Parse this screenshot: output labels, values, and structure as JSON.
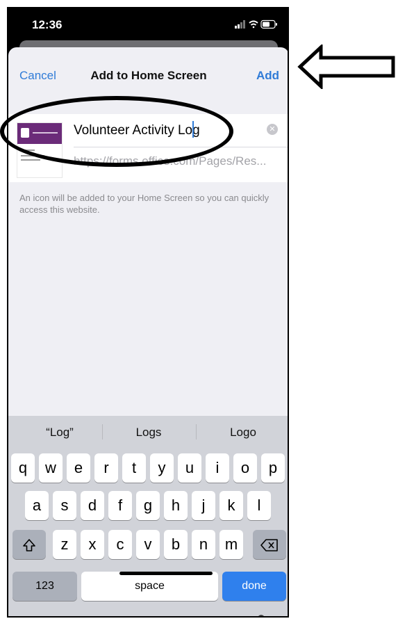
{
  "status_bar": {
    "time": "12:36",
    "icons": [
      "signal-icon",
      "wifi-icon",
      "battery-icon"
    ]
  },
  "nav": {
    "cancel_label": "Cancel",
    "title": "Add to Home Screen",
    "add_label": "Add"
  },
  "form": {
    "name_value": "Volunteer Activity Log",
    "url": "https://forms.office.com/Pages/Res...",
    "help_text": "An icon will be added to your Home Screen so you can quickly access this website."
  },
  "keyboard": {
    "suggestions": [
      "“Log”",
      "Logs",
      "Logo"
    ],
    "row1": [
      "q",
      "w",
      "e",
      "r",
      "t",
      "y",
      "u",
      "i",
      "o",
      "p"
    ],
    "row2": [
      "a",
      "s",
      "d",
      "f",
      "g",
      "h",
      "j",
      "k",
      "l"
    ],
    "row3": [
      "z",
      "x",
      "c",
      "v",
      "b",
      "n",
      "m"
    ],
    "numbers_label": "123",
    "space_label": "space",
    "done_label": "done"
  },
  "colors": {
    "accent": "#2f7bd7",
    "done_key": "#2f80ed",
    "sheet_bg": "#efeff4",
    "keyboard_bg": "#d1d3d9",
    "annotation": "#000000"
  }
}
